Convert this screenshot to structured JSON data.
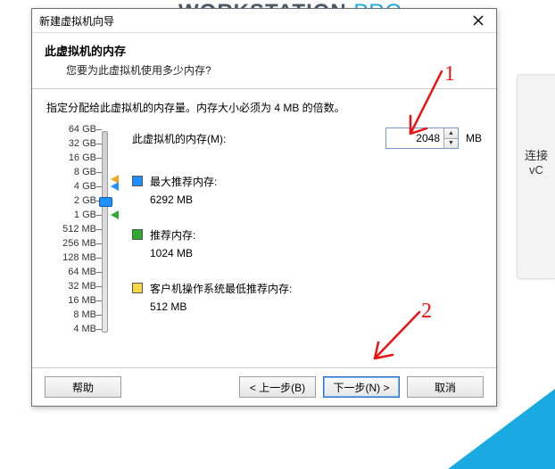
{
  "background": {
    "brand_left": "WORKSTATION",
    "brand_right": "PRO",
    "side_line1": "连接",
    "side_line2": "vC"
  },
  "dialog": {
    "title": "新建虚拟机向导",
    "header": "此虚拟机的内存",
    "subheader": "您要为此虚拟机使用多少内存?",
    "tip": "指定分配给此虚拟机的内存量。内存大小必须为 4 MB 的倍数。"
  },
  "field": {
    "label": "此虚拟机的内存(M):",
    "value": "2048",
    "unit": "MB"
  },
  "scale": {
    "labels": [
      "64 GB",
      "32 GB",
      "16 GB",
      "8 GB",
      "4 GB",
      "2 GB",
      "1 GB",
      "512 MB",
      "256 MB",
      "128 MB",
      "64 MB",
      "32 MB",
      "16 MB",
      "8 MB",
      "4 MB"
    ],
    "thumb_index": 5,
    "markers": {
      "max_index": 4,
      "rec_index": 6,
      "min_index": 7
    }
  },
  "recommendations": {
    "max": {
      "label": "最大推荐内存:",
      "value": "6292 MB"
    },
    "rec": {
      "label": "推荐内存:",
      "value": "1024 MB"
    },
    "min": {
      "label": "客户机操作系统最低推荐内存:",
      "value": "512 MB"
    }
  },
  "buttons": {
    "help": "帮助",
    "back": "< 上一步(B)",
    "next": "下一步(N) >",
    "cancel": "取消"
  },
  "annotations": {
    "one": "1",
    "two": "2"
  }
}
